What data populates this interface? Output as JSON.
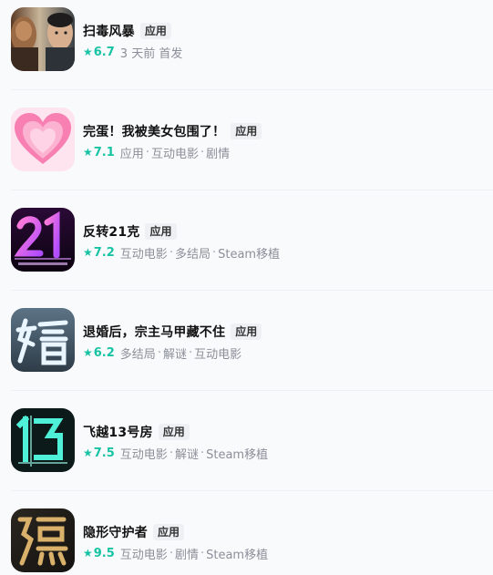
{
  "colors": {
    "accent": "#17c3a4",
    "title": "#111111",
    "meta": "#8b8f99",
    "badge_bg": "#eef0f4"
  },
  "items": [
    {
      "title": "扫毒风暴",
      "badge": "应用",
      "score": "6.7",
      "tags": [
        "3 天前 首发"
      ],
      "icon": "movie-poster-two-men-icon"
    },
    {
      "title": "完蛋！我被美女包围了！",
      "badge": "应用",
      "score": "7.1",
      "tags": [
        "应用",
        "互动电影",
        "剧情"
      ],
      "icon": "pink-heart-icon"
    },
    {
      "title": "反转21克",
      "badge": "应用",
      "score": "7.2",
      "tags": [
        "互动电影",
        "多结局",
        "Steam移植"
      ],
      "icon": "21-grams-logo-icon"
    },
    {
      "title": "退婚后，宗主马甲藏不住",
      "badge": "应用",
      "score": "6.2",
      "tags": [
        "多结局",
        "解谜",
        "互动电影"
      ],
      "icon": "hun-character-icon"
    },
    {
      "title": "飞越13号房",
      "badge": "应用",
      "score": "7.5",
      "tags": [
        "互动电影",
        "解谜",
        "Steam移植"
      ],
      "icon": "number-13-logo-icon"
    },
    {
      "title": "隐形守护者",
      "badge": "应用",
      "score": "9.5",
      "tags": [
        "互动电影",
        "剧情",
        "Steam移植"
      ],
      "icon": "yin-character-icon"
    }
  ]
}
